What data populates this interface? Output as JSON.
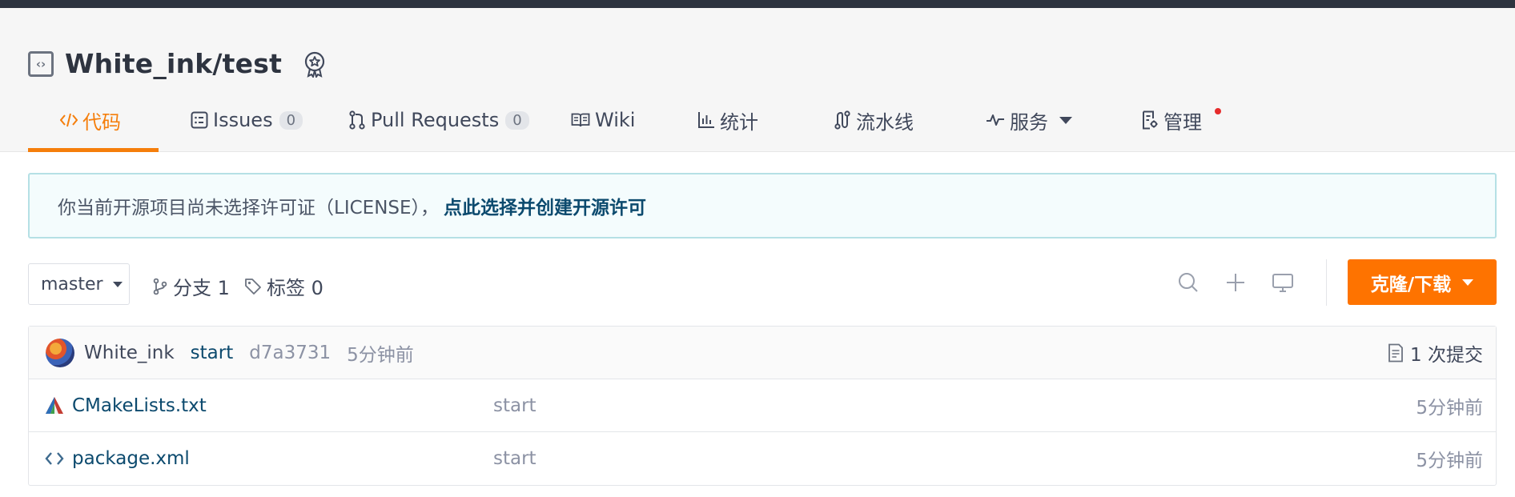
{
  "repo": {
    "name": "White_ink/test"
  },
  "tabs": [
    {
      "label": "代码"
    },
    {
      "label": "Issues",
      "count": "0"
    },
    {
      "label": "Pull Requests",
      "count": "0"
    },
    {
      "label": "Wiki"
    },
    {
      "label": "统计"
    },
    {
      "label": "流水线"
    },
    {
      "label": "服务"
    },
    {
      "label": "管理"
    }
  ],
  "notice": {
    "message": "你当前开源项目尚未选择许可证（LICENSE），",
    "link": "点此选择并创建开源许可"
  },
  "toolbar": {
    "branch": "master",
    "branches": "分支 1",
    "tags": "标签 0",
    "clone_label": "克隆/下载"
  },
  "commit": {
    "author": "White_ink",
    "message": "start",
    "sha": "d7a3731",
    "time": "5分钟前",
    "count": "1 次提交"
  },
  "files": [
    {
      "name": "CMakeLists.txt",
      "message": "start",
      "time": "5分钟前"
    },
    {
      "name": "package.xml",
      "message": "start",
      "time": "5分钟前"
    }
  ],
  "colors": {
    "accent": "#fe7300",
    "tab_active": "#f57e0b",
    "link": "#0c4a6e",
    "topbar": "#2e3440"
  }
}
